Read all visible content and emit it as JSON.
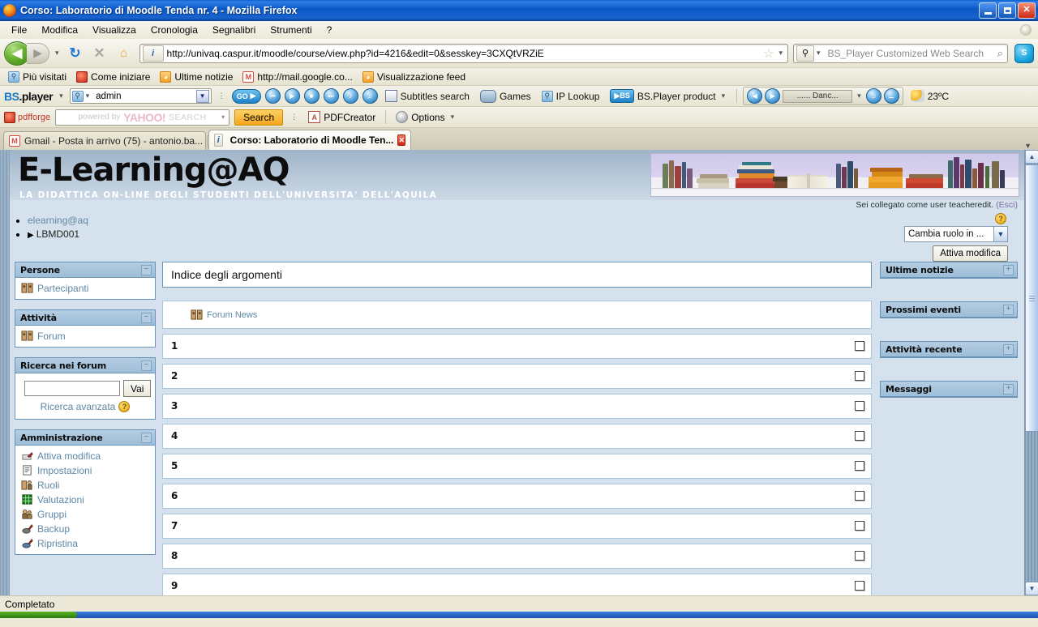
{
  "window": {
    "title": "Corso: Laboratorio di Moodle Tenda nr. 4 - Mozilla Firefox",
    "minimize": "_",
    "maximize": "❐",
    "close": "✕"
  },
  "menubar": [
    "File",
    "Modifica",
    "Visualizza",
    "Cronologia",
    "Segnalibri",
    "Strumenti",
    "?"
  ],
  "navbar": {
    "back": "◀",
    "forward": "▶",
    "dropdown": "▾",
    "reload": "↻",
    "stop": "✕",
    "home": "⌂",
    "identity": "i",
    "url": "http://univaq.caspur.it/moodle/course/view.php?id=4216&edit=0&sesskey=3CXQtVRZiE",
    "bookmark_star": "☆",
    "search_placeholder": "BS_Player Customized Web Search",
    "search_icon": "⌕",
    "skype_label": "S"
  },
  "bookmarks": [
    {
      "label": "Più visitati",
      "icon": "bookmark-folder-icon"
    },
    {
      "label": "Come iniziare",
      "icon": "firefox-icon"
    },
    {
      "label": "Ultime notizie",
      "icon": "rss-icon"
    },
    {
      "label": "http://mail.google.co...",
      "icon": "gmail-icon"
    },
    {
      "label": "Visualizzazione feed",
      "icon": "rss-icon"
    }
  ],
  "bsplayer_toolbar": {
    "logo_bs": "BS",
    "logo_rest": ".player",
    "combo_value": "admin",
    "go_label": "GO",
    "transport": [
      "⏮",
      "▶",
      "■",
      "⏭"
    ],
    "audio_btns": [
      "♪",
      "♫"
    ],
    "items": [
      {
        "label": "Subtitles search",
        "icon": "film-icon"
      },
      {
        "label": "Games",
        "icon": "gamepad-icon"
      },
      {
        "label": "IP Lookup",
        "icon": "magnifier-icon"
      },
      {
        "label": "BS.Player product",
        "icon": "bsplayer-icon"
      }
    ],
    "media_lcd": "...... Danc...",
    "temperature": "23ºC"
  },
  "pdf_toolbar": {
    "brand": "pdfforge",
    "yahoo_powered": "powered by",
    "yahoo_brand": "YAHOO!",
    "yahoo_search": "SEARCH",
    "search_button": "Search",
    "pdfcreator": "PDFCreator",
    "options": "Options"
  },
  "tabs": [
    {
      "label": "Gmail - Posta in arrivo (75) - antonio.ba...",
      "active": false
    },
    {
      "label": "Corso: Laboratorio di Moodle Ten...",
      "active": true
    }
  ],
  "site": {
    "title": "E-Learning@AQ",
    "subtitle": "LA DIDATTICA ON-LINE DEGLI STUDENTI DELL'UNIVERSITA' DELL'AQUILA",
    "login_prefix": "Sei collegato come ",
    "login_user": "user teacheredit",
    "login_logout": "(Esci)"
  },
  "breadcrumb": [
    {
      "label": "elearning@aq",
      "link": true
    },
    {
      "label": "LBMD001",
      "link": false,
      "arrow": "▶"
    }
  ],
  "controls": {
    "help_icon": "?",
    "role_select_value": "Cambia ruolo in ...",
    "role_select_arrow": "▾",
    "edit_button": "Attiva modifica"
  },
  "blocks_left": [
    {
      "title": "Persone",
      "toggle": "−",
      "links": [
        {
          "label": "Partecipanti",
          "icon": "people-icon"
        }
      ]
    },
    {
      "title": "Attività",
      "toggle": "−",
      "links": [
        {
          "label": "Forum",
          "icon": "forum-icon"
        }
      ]
    },
    {
      "title": "Ricerca nei forum",
      "toggle": "−",
      "search_value": "",
      "search_button": "Vai",
      "advanced_label": "Ricerca avanzata",
      "advanced_help": "?"
    },
    {
      "title": "Amministrazione",
      "toggle": "−",
      "links": [
        {
          "label": "Attiva modifica",
          "icon": "pencil-icon"
        },
        {
          "label": "Impostazioni",
          "icon": "settings-icon"
        },
        {
          "label": "Ruoli",
          "icon": "roles-icon"
        },
        {
          "label": "Valutazioni",
          "icon": "grades-icon"
        },
        {
          "label": "Gruppi",
          "icon": "groups-icon"
        },
        {
          "label": "Backup",
          "icon": "backup-icon"
        },
        {
          "label": "Ripristina",
          "icon": "restore-icon"
        }
      ]
    }
  ],
  "blocks_right": [
    {
      "title": "Ultime notizie",
      "toggle": "+"
    },
    {
      "title": "Prossimi eventi",
      "toggle": "+"
    },
    {
      "title": "Attività recente",
      "toggle": "+"
    },
    {
      "title": "Messaggi",
      "toggle": "+"
    }
  ],
  "course": {
    "index_title": "Indice degli argomenti",
    "news_forum": "Forum News",
    "sections": [
      "1",
      "2",
      "3",
      "4",
      "5",
      "6",
      "7",
      "8",
      "9"
    ]
  },
  "statusbar": {
    "text": "Completato"
  },
  "colors": {
    "title_blue": "#0a58c8",
    "block_header": "#9dbdd7",
    "page_bg": "#d5e2ee",
    "link": "#5d87a5",
    "accent_orange": "#f3a81c"
  }
}
